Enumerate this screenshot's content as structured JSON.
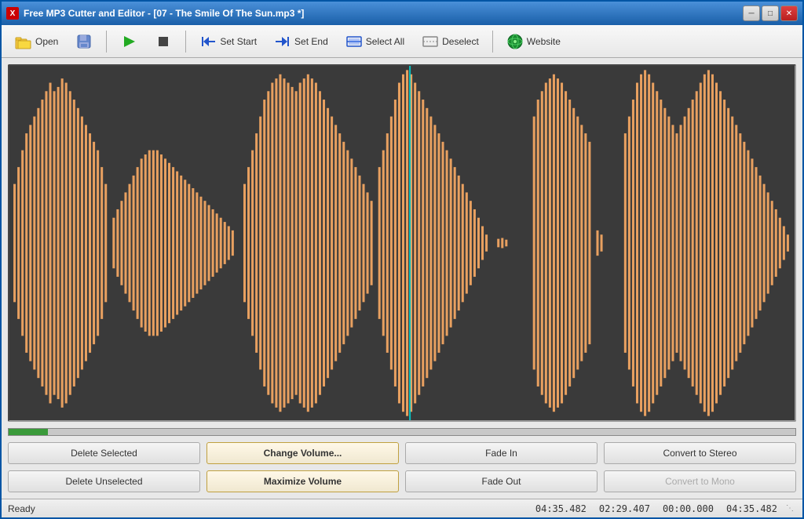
{
  "window": {
    "title": "Free MP3 Cutter and Editor - [07 - The Smile Of The Sun.mp3 *]",
    "icon_label": "X"
  },
  "title_controls": {
    "minimize": "─",
    "maximize": "□",
    "close": "✕"
  },
  "toolbar": {
    "open_label": "Open",
    "save_label": "💾",
    "play_label": "▶",
    "stop_label": "■",
    "set_start_label": "Set Start",
    "set_end_label": "Set End",
    "select_all_label": "Select All",
    "deselect_label": "Deselect",
    "website_label": "Website"
  },
  "buttons": {
    "row1": [
      {
        "id": "delete-selected",
        "label": "Delete Selected",
        "highlighted": false,
        "disabled": false
      },
      {
        "id": "change-volume",
        "label": "Change Volume...",
        "highlighted": true,
        "disabled": false
      },
      {
        "id": "fade-in",
        "label": "Fade In",
        "highlighted": false,
        "disabled": false
      },
      {
        "id": "convert-to-stereo",
        "label": "Convert to Stereo",
        "highlighted": false,
        "disabled": false
      }
    ],
    "row2": [
      {
        "id": "delete-unselected",
        "label": "Delete Unselected",
        "highlighted": false,
        "disabled": false
      },
      {
        "id": "maximize-volume",
        "label": "Maximize Volume",
        "highlighted": true,
        "disabled": false
      },
      {
        "id": "fade-out",
        "label": "Fade Out",
        "highlighted": false,
        "disabled": false
      },
      {
        "id": "convert-to-mono",
        "label": "Convert to Mono",
        "highlighted": false,
        "disabled": true
      }
    ]
  },
  "status": {
    "text": "Ready",
    "time1": "04:35.482",
    "time2": "02:29.407",
    "time3": "00:00.000",
    "time4": "04:35.482"
  },
  "colors": {
    "waveform_bg": "#3a3a3a",
    "waveform_fill": "#e8a060",
    "waveform_selected": "#e8a060",
    "cursor_color": "#00d0d0",
    "progress_color": "#3a9a3a"
  }
}
